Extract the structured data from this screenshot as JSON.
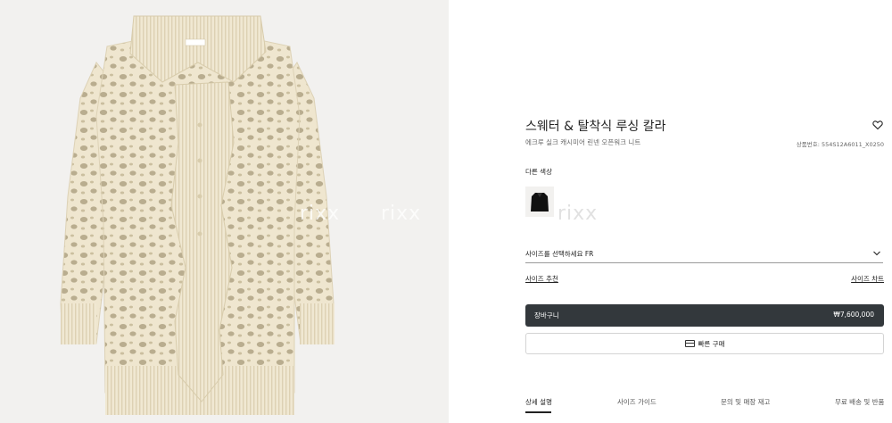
{
  "product": {
    "title": "스웨터 & 탈착식 루싱 칼라",
    "subtitle": "에크루 실크 캐시미어 린넨 오픈워크 니트",
    "sku": "상품번호: 554S12A6011_X0250"
  },
  "watermark": "rixx",
  "colors": {
    "label": "다른 색상",
    "swatches": [
      {
        "name": "black",
        "hex": "#111111"
      }
    ]
  },
  "size": {
    "placeholder": "사이즈를 선택하세요 FR",
    "recommend_label": "사이즈 추천",
    "chart_label": "사이즈 차트"
  },
  "cart": {
    "label": "장바구니",
    "price": "₩7,600,000"
  },
  "quick_buy": {
    "label": "빠른 구매"
  },
  "tabs": [
    {
      "label": "상세 설명",
      "active": true
    },
    {
      "label": "사이즈 가이드",
      "active": false
    },
    {
      "label": "문의 및 매장 재고",
      "active": false
    },
    {
      "label": "무료 배송 및 반품",
      "active": false
    }
  ],
  "theme": {
    "image_bg": "#f2f1ef",
    "knit": "#efe6cf",
    "button_dark": "#33383c"
  }
}
